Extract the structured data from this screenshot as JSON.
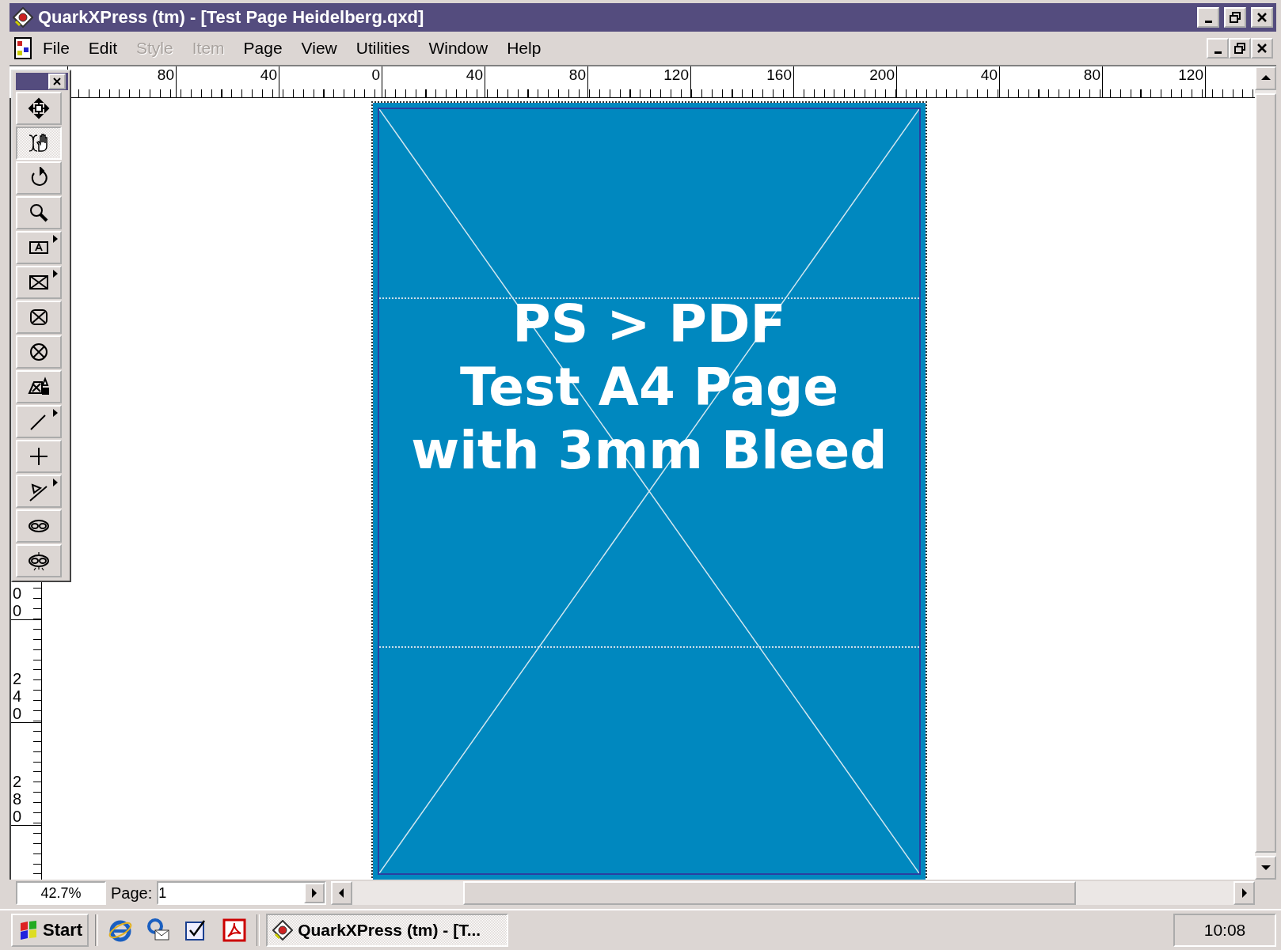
{
  "window": {
    "title": "QuarkXPress (tm) - [Test Page Heidelberg.qxd]"
  },
  "menu": [
    {
      "label": "File",
      "disabled": false
    },
    {
      "label": "Edit",
      "disabled": false
    },
    {
      "label": "Style",
      "disabled": true
    },
    {
      "label": "Item",
      "disabled": true
    },
    {
      "label": "Page",
      "disabled": false
    },
    {
      "label": "View",
      "disabled": false
    },
    {
      "label": "Utilities",
      "disabled": false
    },
    {
      "label": "Window",
      "disabled": false
    },
    {
      "label": "Help",
      "disabled": false
    }
  ],
  "ruler_top": {
    "labels": [
      "80",
      "40",
      "0",
      "40",
      "80",
      "120",
      "160",
      "200",
      "40",
      "80",
      "120"
    ]
  },
  "ruler_left": {
    "labels": [
      "00",
      "240",
      "280"
    ]
  },
  "tools": [
    {
      "kind": "move",
      "selected": false,
      "popout": false
    },
    {
      "kind": "content",
      "selected": true,
      "popout": false
    },
    {
      "kind": "rotate",
      "selected": false,
      "popout": false
    },
    {
      "kind": "zoom",
      "selected": false,
      "popout": false
    },
    {
      "kind": "textbox",
      "selected": false,
      "popout": true
    },
    {
      "kind": "picturebox",
      "selected": false,
      "popout": true
    },
    {
      "kind": "roundbox",
      "selected": false,
      "popout": false
    },
    {
      "kind": "ovalbox",
      "selected": false,
      "popout": false
    },
    {
      "kind": "bezierbox",
      "selected": false,
      "popout": false
    },
    {
      "kind": "line",
      "selected": false,
      "popout": true
    },
    {
      "kind": "ortholine",
      "selected": false,
      "popout": false
    },
    {
      "kind": "textpath",
      "selected": false,
      "popout": true
    },
    {
      "kind": "link",
      "selected": false,
      "popout": false
    },
    {
      "kind": "unlink",
      "selected": false,
      "popout": false
    }
  ],
  "page": {
    "lines": [
      "PS > PDF",
      "Test A4 Page",
      "with 3mm Bleed"
    ]
  },
  "status": {
    "zoom": "42.7%",
    "page_label": "Page:",
    "page_value": "1"
  },
  "taskbar": {
    "start": "Start",
    "task": "QuarkXPress (tm) - [T...",
    "clock": "10:08"
  }
}
